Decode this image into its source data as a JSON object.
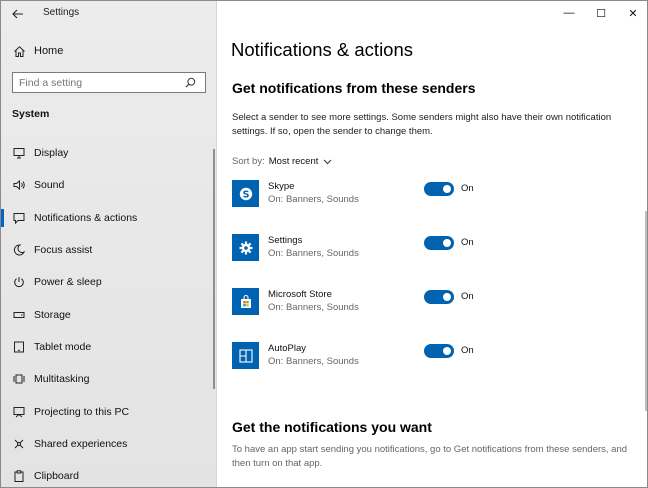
{
  "window": {
    "title": "Settings",
    "controls": {
      "minimize": "—",
      "maximize": "☐",
      "close": "✕"
    }
  },
  "sidebar": {
    "home_label": "Home",
    "search_placeholder": "Find a setting",
    "section_label": "System",
    "items": [
      {
        "label": "Display",
        "icon": "display-icon"
      },
      {
        "label": "Sound",
        "icon": "speaker-icon"
      },
      {
        "label": "Notifications & actions",
        "icon": "notification-icon",
        "active": true
      },
      {
        "label": "Focus assist",
        "icon": "moon-icon"
      },
      {
        "label": "Power & sleep",
        "icon": "power-icon"
      },
      {
        "label": "Storage",
        "icon": "storage-icon"
      },
      {
        "label": "Tablet mode",
        "icon": "tablet-icon"
      },
      {
        "label": "Multitasking",
        "icon": "multitasking-icon"
      },
      {
        "label": "Projecting to this PC",
        "icon": "projecting-icon"
      },
      {
        "label": "Shared experiences",
        "icon": "shared-icon"
      },
      {
        "label": "Clipboard",
        "icon": "clipboard-icon"
      }
    ]
  },
  "main": {
    "page_title": "Notifications & actions",
    "section1_title": "Get notifications from these senders",
    "section1_desc": "Select a sender to see more settings. Some senders might also have their own notification settings. If so, open the sender to change them.",
    "sort_label": "Sort by:",
    "sort_value": "Most recent",
    "senders": [
      {
        "name": "Skype",
        "sub": "On: Banners, Sounds",
        "toggle": "On",
        "icon": "skype-icon",
        "enabled": true
      },
      {
        "name": "Settings",
        "sub": "On: Banners, Sounds",
        "toggle": "On",
        "icon": "gear-icon",
        "enabled": true
      },
      {
        "name": "Microsoft Store",
        "sub": "On: Banners, Sounds",
        "toggle": "On",
        "icon": "store-icon",
        "enabled": true
      },
      {
        "name": "AutoPlay",
        "sub": "On: Banners, Sounds",
        "toggle": "On",
        "icon": "autoplay-icon",
        "enabled": true
      }
    ],
    "section2_title": "Get the notifications you want",
    "section2_desc": "To have an app start sending you notifications, go to Get notifications from these senders, and then turn on that app."
  },
  "colors": {
    "accent": "#0063b1",
    "sidebar_bg": "#e6e6e6",
    "active_bar": "#0067c0"
  }
}
